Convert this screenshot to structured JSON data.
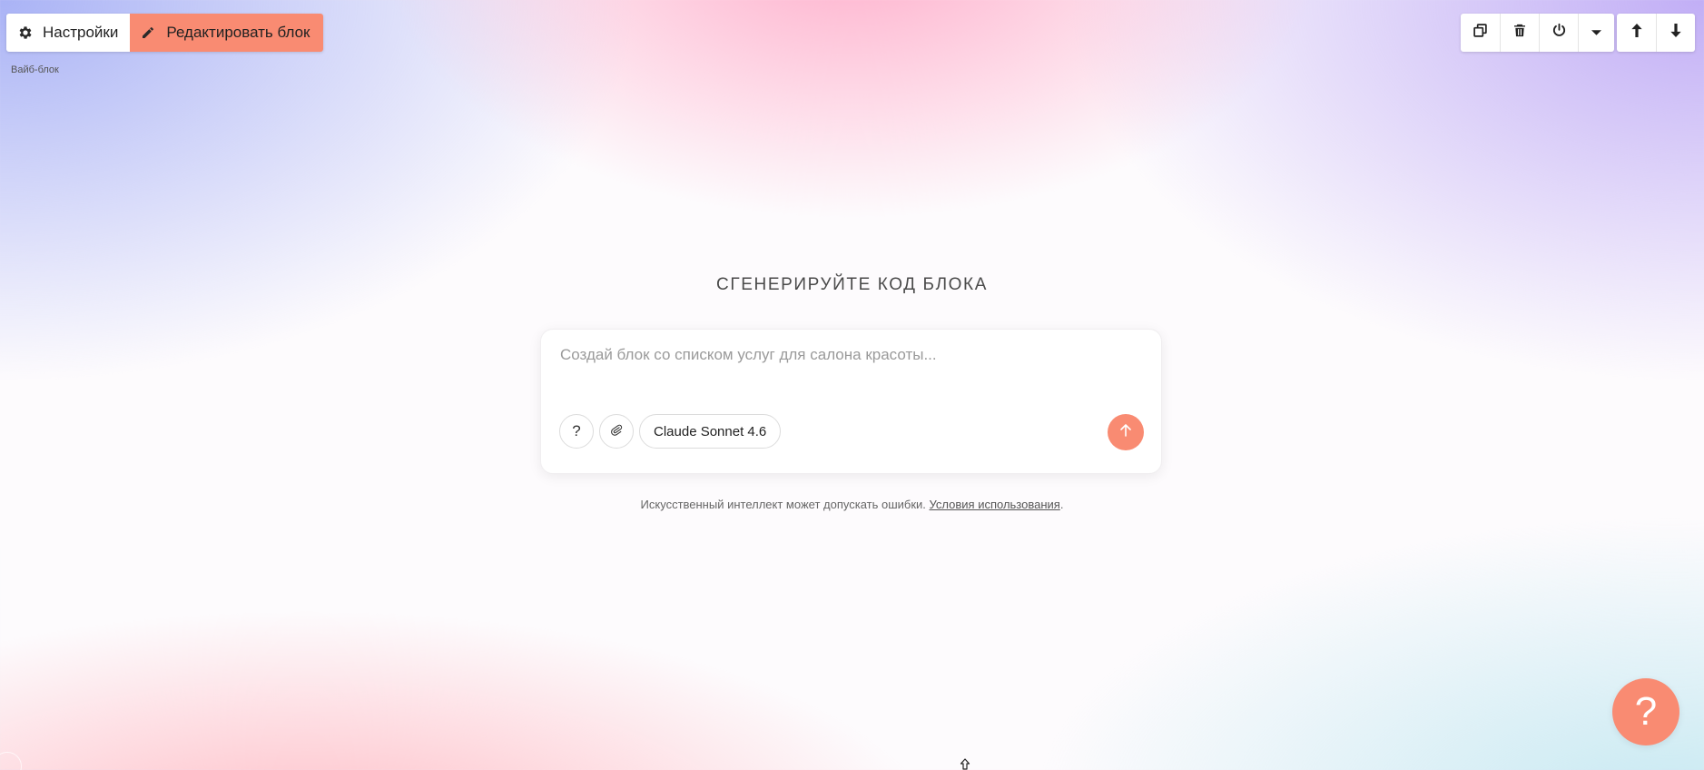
{
  "editor": {
    "settings_label": "Настройки",
    "edit_label": "Редактировать блок",
    "block_label": "Вайб-блок"
  },
  "main": {
    "headline": "СГЕНЕРИРУЙТЕ КОД БЛОКА",
    "prompt_placeholder": "Создай блок со списком услуг для салона красоты...",
    "prompt_value": "",
    "model_name": "Claude Sonnet 4.6",
    "help_symbol": "?",
    "disclaimer_text": "Искусственный интеллект может допускать ошибки.",
    "terms_link": "Условия использования",
    "disclaimer_end": "."
  },
  "help_bubble": {
    "symbol": "?"
  },
  "colors": {
    "accent": "#f98b72"
  },
  "icons": {
    "settings": "gear-icon",
    "edit": "pencil-icon",
    "duplicate": "copy-icon",
    "delete": "trash-icon",
    "toggle": "power-icon",
    "more": "caret-down-icon",
    "move_up": "arrow-up-icon",
    "move_down": "arrow-down-icon",
    "attach": "paperclip-icon",
    "send": "arrow-up-icon"
  }
}
